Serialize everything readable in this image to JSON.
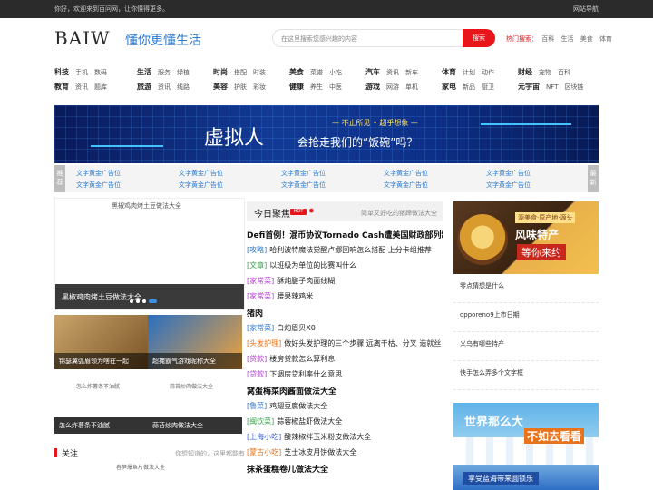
{
  "topbar": {
    "welcome": "你好，欢迎来到百问网，让你懂得更多。",
    "nav": "网站导航"
  },
  "header": {
    "logo": "BAIW",
    "slogan": "懂你更懂生活",
    "search_placeholder": "在这里搜索您感兴趣的内容",
    "search_button": "搜索",
    "hot_label": "热门搜索：",
    "hot_words": [
      "百科",
      "生活",
      "美食",
      "体育"
    ]
  },
  "categories": [
    {
      "main": "科技",
      "subs": [
        "手机",
        "数码"
      ]
    },
    {
      "main": "生活",
      "subs": [
        "服务",
        "绿植"
      ]
    },
    {
      "main": "时尚",
      "subs": [
        "搭配",
        "时装"
      ]
    },
    {
      "main": "美食",
      "subs": [
        "菜谱",
        "小吃"
      ]
    },
    {
      "main": "汽车",
      "subs": [
        "资讯",
        "新车"
      ]
    },
    {
      "main": "体育",
      "subs": [
        "计划",
        "动作"
      ]
    },
    {
      "main": "财经",
      "subs": [
        "宠物",
        "百科"
      ]
    },
    {
      "main": "教育",
      "subs": [
        "资讯",
        "题库"
      ]
    },
    {
      "main": "旅游",
      "subs": [
        "资讯",
        "线路"
      ]
    },
    {
      "main": "美容",
      "subs": [
        "护肤",
        "彩妆"
      ]
    },
    {
      "main": "健康",
      "subs": [
        "养生",
        "中医"
      ]
    },
    {
      "main": "游戏",
      "subs": [
        "网游",
        "单机"
      ]
    },
    {
      "main": "家电",
      "subs": [
        "新品",
        "厨卫"
      ]
    },
    {
      "main": "元宇宙",
      "subs": [
        "NFT",
        "区块链"
      ]
    }
  ],
  "banner": {
    "big": "虚拟人",
    "line1": "— 不止所见 • 超乎想象 —",
    "line2": "会抢走我们的“饭碗”吗？"
  },
  "adrow": {
    "left": "推荐",
    "right": "最新",
    "ad_text": "文字黄金广告位",
    "rows": 2,
    "cols": 5
  },
  "slider": {
    "img_alt": "黑椒鸡肉烤土豆做法大全",
    "caption": "黑椒鸡肉烤土豆做法大全"
  },
  "tiles": [
    {
      "label": "锦瑟翼弧眉领为啥在一起"
    },
    {
      "label": "超掩霸气游戏昵称大全"
    },
    {
      "alt": "怎么炸薯条不油腻",
      "label": "怎么炸薯条不油腻"
    },
    {
      "alt": "蒜苔炒肉做法大全",
      "label": "蒜苔炒肉做法大全"
    }
  ],
  "focus": {
    "title": "关注",
    "sub": "你想知道的，这里都能有",
    "img_alt": "春笋爆鱼片做法大全"
  },
  "today": {
    "title": "今日聚焦",
    "badge": "HOT",
    "sub": "简单又好吃的猪蹄做法大全"
  },
  "news": [
    {
      "type": "h",
      "text": "Defi首例！混币协议Tornado Cash遭美国财政部列制"
    },
    {
      "tag": "[攻略]",
      "cls": "",
      "text": "哈利波特魔法觉醒卢娜回响怎么搭配 上分卡组推荐"
    },
    {
      "tag": "[文章]",
      "cls": "g",
      "text": "以班级为单位的比赛叫什么"
    },
    {
      "tag": "[家常菜]",
      "cls": "p",
      "text": "酥炖腱子肉面线糊"
    },
    {
      "tag": "[家常菜]",
      "cls": "p",
      "text": "腰果辣鸡米"
    },
    {
      "type": "h",
      "text": "猪肉"
    },
    {
      "tag": "[家常菜]",
      "cls": "",
      "text": "白灼眉贝X0"
    },
    {
      "tag": "[头发护理]",
      "cls": "o",
      "text": "做好头发护理的三个步骤 远离干枯、分叉 造就丝"
    },
    {
      "tag": "[贷款]",
      "cls": "p",
      "text": "楼房贷款怎么算利息"
    },
    {
      "tag": "[贷款]",
      "cls": "p",
      "text": "下调房贷利率什么意思"
    },
    {
      "type": "h",
      "text": "窝蛋梅菜肉酱面做法大全"
    },
    {
      "tag": "[鲁菜]",
      "cls": "",
      "text": "鸡翅豆腐做法大全"
    },
    {
      "tag": "[闽饮菜]",
      "cls": "g",
      "text": "蒜蓉椒盐虾做法大全"
    },
    {
      "tag": "[上海小吃]",
      "cls": "b",
      "text": "酸辣椒拌玉米粉皮做法大全"
    },
    {
      "tag": "[蒙古小吃]",
      "cls": "o",
      "text": "芝士冰皮月饼做法大全"
    },
    {
      "type": "h",
      "text": "抹茶蛋糕卷儿做法大全"
    }
  ],
  "promo1": {
    "tag": "源美食·原产地·源头",
    "line1": "风味特产",
    "line2": "等你来约"
  },
  "questions": [
    "零点猜想是什么",
    "opporeno9上市日期",
    "义乌有哪些特产",
    "快手怎么弄多个文字框"
  ],
  "promo2": {
    "line1": "世界那么大",
    "line2": "不如去看看",
    "line3": "享受蓝海带来圆锁乐"
  }
}
